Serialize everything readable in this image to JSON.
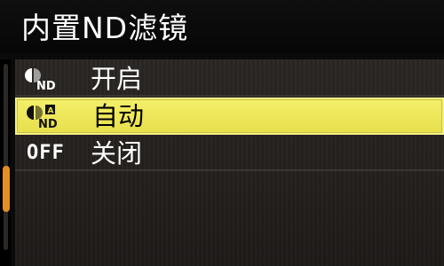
{
  "menu": {
    "title": "内置ND滤镜",
    "options": [
      {
        "label": "开启",
        "icon": "nd-filter-on-icon",
        "icon_text": "ND"
      },
      {
        "label": "自动",
        "icon": "nd-filter-auto-icon",
        "icon_text": "ND",
        "icon_badge": "A",
        "selected": true
      },
      {
        "label": "关闭",
        "icon_text": "OFF"
      }
    ]
  },
  "colors": {
    "highlight": "#ebe356",
    "scrollbar_thumb": "#e38f26",
    "background": "#0a0a0a"
  }
}
